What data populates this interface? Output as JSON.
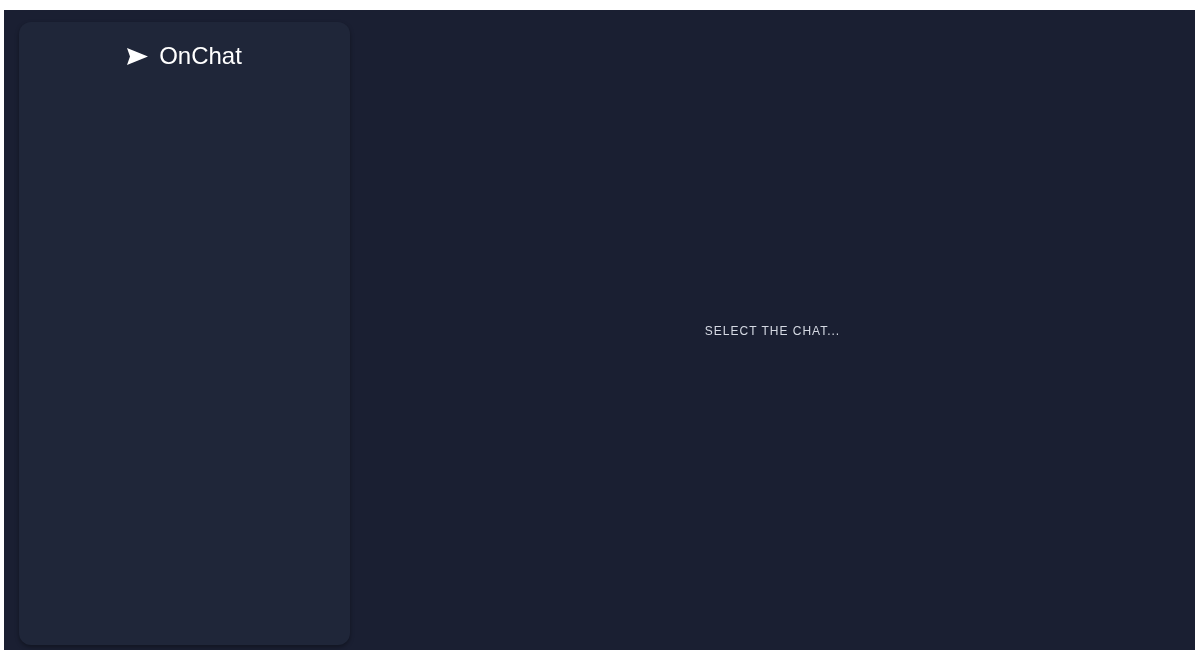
{
  "sidebar": {
    "logo": {
      "title": "OnChat"
    }
  },
  "main": {
    "placeholder_text": "SELECT THE CHAT..."
  }
}
